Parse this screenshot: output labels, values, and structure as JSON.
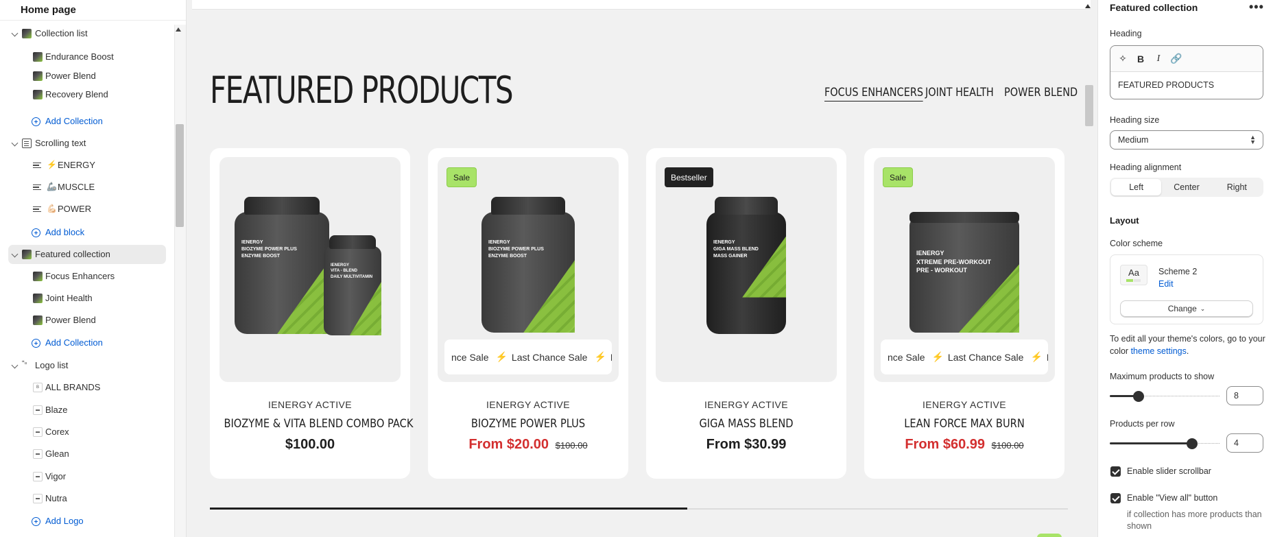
{
  "sidebar": {
    "page_title": "Home page",
    "sections": [
      {
        "label": "Collection list",
        "blocks": [
          "Endurance Boost",
          "Power Blend",
          "Recovery Blend"
        ],
        "add_label": "Add Collection"
      },
      {
        "label": "Scrolling text",
        "blocks": [
          {
            "emoji": "⚡",
            "label": "ENERGY"
          },
          {
            "emoji": "🦾",
            "label": "MUSCLE"
          },
          {
            "emoji": "💪🏻",
            "label": "POWER"
          }
        ],
        "add_label": "Add block"
      },
      {
        "label": "Featured collection",
        "blocks": [
          "Focus Enhancers",
          "Joint Health",
          "Power Blend"
        ],
        "add_label": "Add Collection"
      },
      {
        "label": "Logo list",
        "blocks": [
          "ALL BRANDS",
          "Blaze",
          "Corex",
          "Glean",
          "Vigor",
          "Nutra"
        ],
        "add_label": "Add Logo"
      }
    ]
  },
  "preview": {
    "heading": "FEATURED PRODUCTS",
    "tabs": [
      "FOCUS ENHANCERS",
      "JOINT HEALTH",
      "POWER BLEND"
    ],
    "active_tab": 0,
    "slider_progress": 0.556,
    "products": [
      {
        "brand": "IENERGY ACTIVE",
        "name": "BIOZYME & VITA BLEND COMBO PACK",
        "price": "$100.00",
        "compare": "",
        "on_sale": false,
        "badge": "",
        "marquee": ""
      },
      {
        "brand": "IENERGY ACTIVE",
        "name": "BIOZYME POWER PLUS",
        "price": "From $20.00",
        "compare": "$100.00",
        "on_sale": true,
        "badge": "Sale",
        "marquee": [
          "nce Sale",
          "Last Chance Sale",
          "La"
        ]
      },
      {
        "brand": "IENERGY ACTIVE",
        "name": "GIGA MASS BLEND",
        "price": "From $30.99",
        "compare": "",
        "on_sale": false,
        "badge": "Bestseller",
        "marquee": ""
      },
      {
        "brand": "IENERGY ACTIVE",
        "name": "LEAN FORCE MAX BURN",
        "price": "From $60.99",
        "compare": "$100.00",
        "on_sale": true,
        "badge": "Sale",
        "marquee": [
          "nce Sale",
          "Last Chance Sale",
          "La"
        ]
      }
    ],
    "bottle_texts": {
      "biozyme": "IENERGY\nBIOZYME POWER PLUS\nENZYME BOOST",
      "vita": "IENERGY\nVITA - BLEND\nDAILY MULTIVITAMIN",
      "giga": "IENERGY\nGIGA MASS BLEND\nMASS GAINER",
      "xtreme": "IENERGY\nXTREME PRE-WORKOUT\nPRE - WORKOUT"
    }
  },
  "settings": {
    "title": "Featured collection",
    "more_label": "•••",
    "heading_label": "Heading",
    "heading_value": "FEATURED PRODUCTS",
    "heading_size_label": "Heading size",
    "heading_size_value": "Medium",
    "alignment_label": "Heading alignment",
    "alignment_options": [
      "Left",
      "Center",
      "Right"
    ],
    "alignment_selected": "Left",
    "layout_heading": "Layout",
    "color_scheme_label": "Color scheme",
    "scheme_swatch_text": "Aa",
    "scheme_name": "Scheme 2",
    "scheme_edit": "Edit",
    "change_label": "Change",
    "hint_text": "To edit all your theme's colors, go to your color",
    "hint_link": "theme settings",
    "hint_end": ".",
    "max_products_label": "Maximum products to show",
    "max_products_value": "8",
    "max_products_range": [
      2,
      25
    ],
    "per_row_label": "Products per row",
    "per_row_value": "4",
    "per_row_range": [
      1,
      5
    ],
    "slider_scrollbar_label": "Enable slider scrollbar",
    "slider_scrollbar_checked": true,
    "view_all_label": "Enable \"View all\" button",
    "view_all_checked": true,
    "view_all_help": "if collection has more products than shown"
  },
  "colors": {
    "accent_blue": "#005bd3",
    "sale_green": "#a8e368",
    "sale_red": "#d32f2f",
    "bolt_orange": "#e86f1d"
  }
}
